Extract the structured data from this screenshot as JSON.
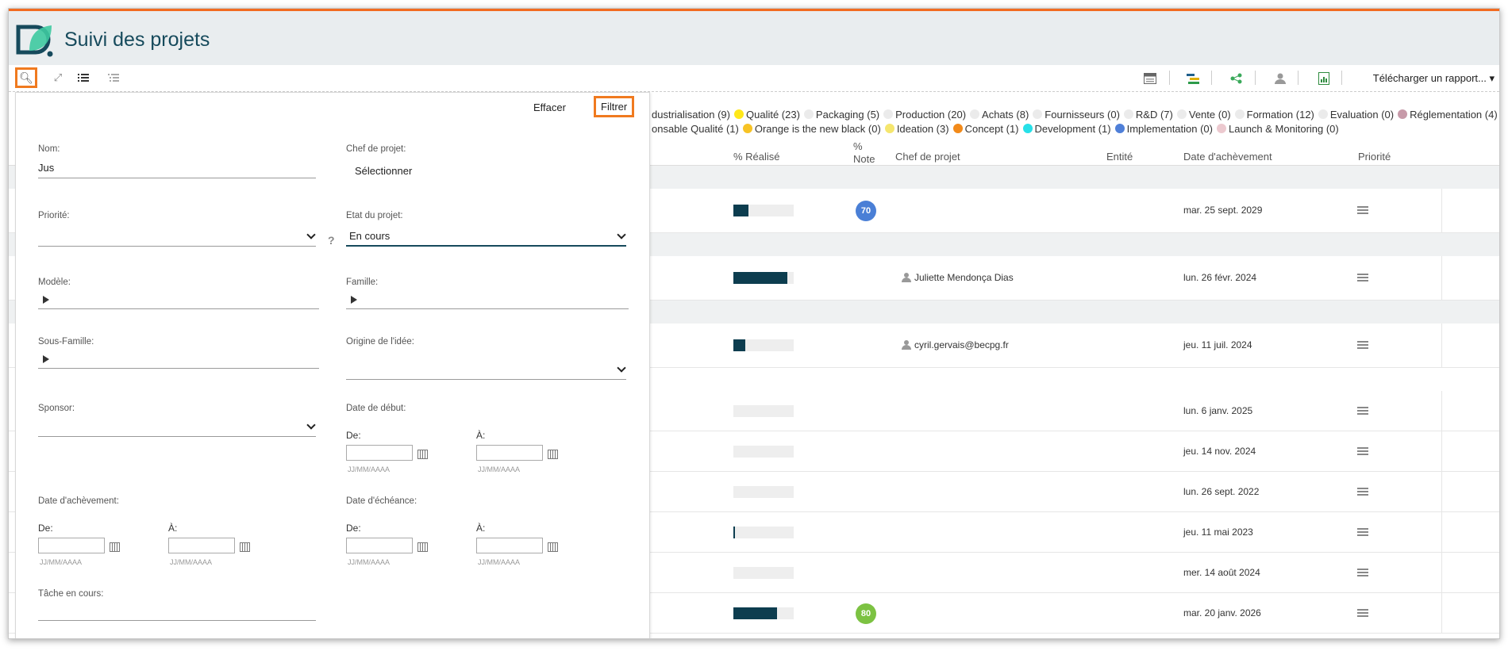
{
  "app": {
    "title": "Suivi des projets"
  },
  "toolbar": {
    "report_label": "Télécharger un rapport...",
    "report_caret": "▾"
  },
  "legend_row1": [
    {
      "label": "dustrialisation (9)",
      "color": ""
    },
    {
      "label": "Qualité (23)",
      "color": "#ffe81a"
    },
    {
      "label": "Packaging (5)",
      "color": "#ebebeb"
    },
    {
      "label": "Production (20)",
      "color": "#ebebeb"
    },
    {
      "label": "Achats (8)",
      "color": "#ebebeb"
    },
    {
      "label": "Fournisseurs (0)",
      "color": "#ebebeb"
    },
    {
      "label": "R&D (7)",
      "color": "#ebebeb"
    },
    {
      "label": "Vente (0)",
      "color": "#ebebeb"
    },
    {
      "label": "Formation (12)",
      "color": "#ebebeb"
    },
    {
      "label": "Evaluation (0)",
      "color": "#ebebeb"
    },
    {
      "label": "Réglementation (4)",
      "color": "#c79aa9"
    }
  ],
  "legend_row2": [
    {
      "label": "onsable Qualité (1)",
      "color": ""
    },
    {
      "label": "Orange is the new black (0)",
      "color": "#f7c325"
    },
    {
      "label": "Ideation (3)",
      "color": "#f5e66e"
    },
    {
      "label": "Concept (1)",
      "color": "#f28a1a"
    },
    {
      "label": "Development (1)",
      "color": "#27e0e8"
    },
    {
      "label": "Implementation (0)",
      "color": "#4f7fd8"
    },
    {
      "label": "Launch & Monitoring (0)",
      "color": "#ecc9cf"
    }
  ],
  "table": {
    "headers": {
      "realise": "% Réalisé",
      "note_top": "%",
      "note_bottom": "Note",
      "chef": "Chef de projet",
      "entite": "Entité",
      "date": "Date d'achèvement",
      "priorite": "Priorité"
    },
    "rows": [
      {
        "progress": 0.25,
        "note": "70",
        "note_color": "#4a7fd6",
        "chef": "",
        "date": "mar. 25 sept. 2029"
      },
      {
        "progress": 0.9,
        "note": "",
        "note_color": "",
        "chef": "Juliette Mendonça Dias",
        "date": "lun. 26 févr. 2024"
      },
      {
        "progress": 0.2,
        "note": "",
        "note_color": "",
        "chef": "cyril.gervais@becpg.fr",
        "date": "jeu. 11 juil. 2024"
      },
      {
        "progress": 0,
        "note": "",
        "note_color": "",
        "chef": "",
        "date": "lun. 6 janv. 2025"
      },
      {
        "progress": 0,
        "note": "",
        "note_color": "",
        "chef": "",
        "date": "jeu. 14 nov. 2024"
      },
      {
        "progress": 0,
        "note": "",
        "note_color": "",
        "chef": "",
        "date": "lun. 26 sept. 2022"
      },
      {
        "progress": 0.02,
        "note": "",
        "note_color": "",
        "chef": "",
        "date": "jeu. 11 mai 2023"
      },
      {
        "progress": 0,
        "note": "",
        "note_color": "",
        "chef": "",
        "date": "mer. 14 août 2024"
      },
      {
        "progress": 0.72,
        "note": "80",
        "note_color": "#7cc242",
        "chef": "",
        "date": "mar. 20 janv. 2026"
      }
    ]
  },
  "filter": {
    "clear_label": "Effacer",
    "apply_label": "Filtrer",
    "nom_label": "Nom:",
    "nom_value": "Jus",
    "chef_label": "Chef de projet:",
    "chef_value": "Sélectionner",
    "priorite_label": "Priorité:",
    "help": "?",
    "etat_label": "Etat du projet:",
    "etat_value": "En cours",
    "modele_label": "Modèle:",
    "famille_label": "Famille:",
    "sousfamille_label": "Sous-Famille:",
    "origine_label": "Origine de l'idée:",
    "sponsor_label": "Sponsor:",
    "debut_label": "Date de début:",
    "achevement_label": "Date d'achèvement:",
    "echeance_label": "Date d'échéance:",
    "tache_label": "Tâche en cours:",
    "de_label": "De:",
    "a_label": "À:",
    "date_hint": "JJ/MM/AAAA"
  }
}
